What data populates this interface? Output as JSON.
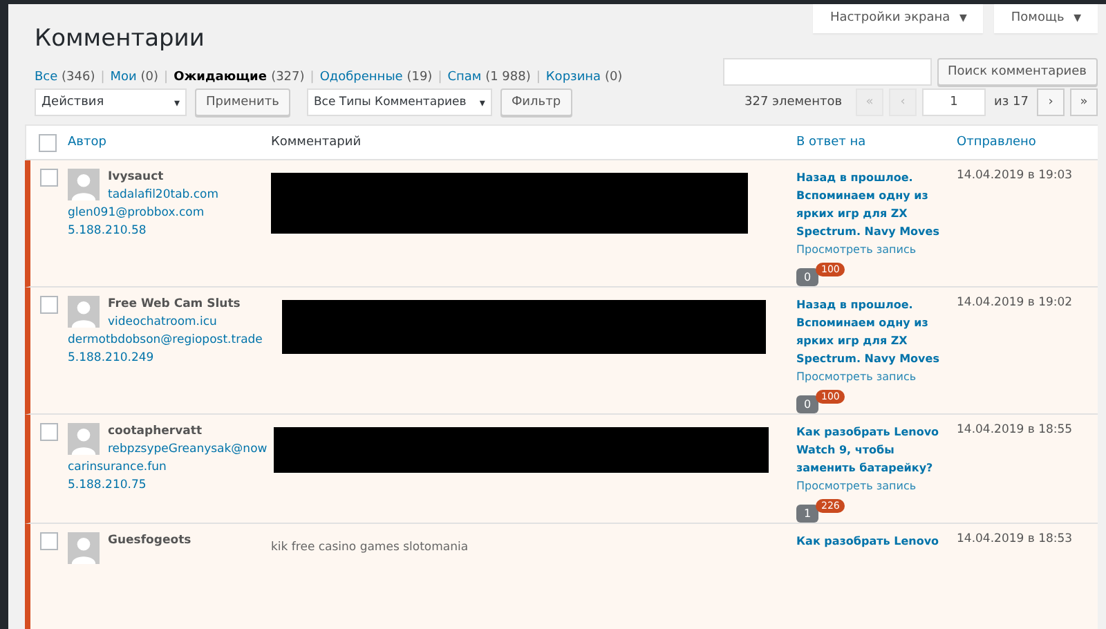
{
  "screen_options": [
    {
      "label": "Настройки экрана",
      "caret": "▼"
    },
    {
      "label": "Помощь",
      "caret": "▼"
    }
  ],
  "title": "Комментарии",
  "filters": [
    {
      "label": "Все",
      "count": "(346)",
      "selected": false
    },
    {
      "separator": "|",
      "label": "Мои",
      "count": "(0)",
      "selected": false
    },
    {
      "separator": "|",
      "label": "Ожидающие",
      "count": "(327)",
      "selected": true
    },
    {
      "separator": "|",
      "label": "Одобренные",
      "count": "(19)",
      "selected": false
    },
    {
      "separator": "|",
      "label": "Спам",
      "count": "(1 988)",
      "selected": false
    },
    {
      "separator": "|",
      "label": "Корзина",
      "count": "(0)",
      "selected": false
    }
  ],
  "search": {
    "button": "Поиск комментариев"
  },
  "bulk_action": {
    "value": "Действия",
    "arrow": "▾",
    "apply": "Применить"
  },
  "type_filter": {
    "value": "Все Типы Комментариев",
    "arrow": "▾",
    "button": "Фильтр"
  },
  "select_all": {
    "checked": false
  },
  "pagination": {
    "count": "327 элементов",
    "first": "«",
    "prev": "‹",
    "page": "1",
    "of": "из 17",
    "next": "›",
    "last": "»"
  },
  "columns": [
    {
      "label": "Автор",
      "sortable": true
    },
    {
      "label": "Комментарий",
      "sortable": false
    },
    {
      "label": "В ответ на",
      "sortable": true
    },
    {
      "label": "Отправлено",
      "sortable": true
    }
  ],
  "rows": [
    {
      "checked": false,
      "unapproved": true,
      "author": "Ivysauct",
      "url": "tadalafil20tab.com",
      "email": "glen091@probbox.com",
      "ip": "5.188.210.58",
      "comment": {
        "kind": "redacted"
      },
      "reply_to": "Назад в прошлое. Вспоминаем одну из ярких игр для ZX Spectrum. Navy Moves",
      "view": "Просмотреть запись",
      "approved_count": "0",
      "pending_count": "100",
      "date": "14.04.2019 в 19:03"
    },
    {
      "checked": false,
      "unapproved": true,
      "author": "Free Web Cam Sluts",
      "url": "videochatroom.icu",
      "email": "dermotbdobson@regiopost.trade",
      "ip": "5.188.210.249",
      "comment": {
        "kind": "redacted"
      },
      "reply_to": "Назад в прошлое. Вспоминаем одну из ярких игр для ZX Spectrum. Navy Moves",
      "view": "Просмотреть запись",
      "approved_count": "0",
      "pending_count": "100",
      "date": "14.04.2019 в 19:02"
    },
    {
      "checked": false,
      "unapproved": true,
      "author": "cootaphervatt",
      "email": "rebpzsypeGreanysak@nowcarinsurance.fun",
      "ip": "5.188.210.75",
      "comment": {
        "kind": "redacted"
      },
      "reply_to": "Как разобрать Lenovo Watch 9, чтобы заменить батарейку?",
      "view": "Просмотреть запись",
      "approved_count": "1",
      "pending_count": "226",
      "date": "14.04.2019 в 18:55"
    },
    {
      "checked": false,
      "unapproved": true,
      "author": "Guesfogeots",
      "comment": {
        "kind": "text",
        "text": "kik free casino games slotomania"
      },
      "reply_to": "Как разобрать Lenovo",
      "date": "14.04.2019 в 18:53"
    }
  ]
}
